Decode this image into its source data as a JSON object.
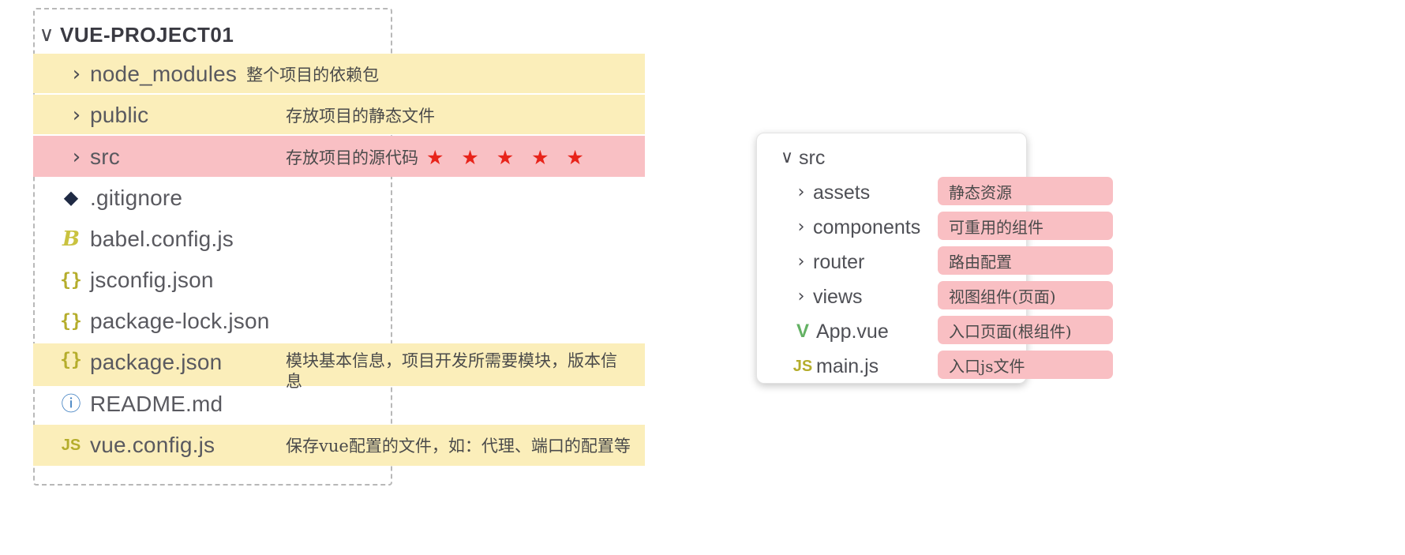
{
  "left_tree": {
    "root": {
      "label": "VUE-PROJECT01",
      "twisty": "∨"
    },
    "items": [
      {
        "twisty": "›",
        "name": "node_modules",
        "desc": "整个项目的依赖包",
        "highlight": "yellow",
        "icon": ""
      },
      {
        "twisty": "›",
        "name": "public",
        "desc": "存放项目的静态文件",
        "highlight": "yellow",
        "icon": ""
      },
      {
        "twisty": "›",
        "name": "src",
        "desc": "存放项目的源代码",
        "stars": "★ ★ ★ ★ ★",
        "highlight": "pink",
        "icon": ""
      },
      {
        "twisty": "",
        "name": ".gitignore",
        "desc": "",
        "highlight": "none",
        "icon": "git-icon",
        "glyph": "◆"
      },
      {
        "twisty": "",
        "name": "babel.config.js",
        "desc": "",
        "highlight": "none",
        "icon": "babel-icon",
        "glyph": "B"
      },
      {
        "twisty": "",
        "name": "jsconfig.json",
        "desc": "",
        "highlight": "none",
        "icon": "json-icon",
        "glyph": "{}"
      },
      {
        "twisty": "",
        "name": "package-lock.json",
        "desc": "",
        "highlight": "none",
        "icon": "json-icon",
        "glyph": "{}"
      },
      {
        "twisty": "",
        "name": "package.json",
        "desc": "模块基本信息，项目开发所需要模块，版本信息",
        "highlight": "yellow",
        "icon": "json-icon",
        "glyph": "{}"
      },
      {
        "twisty": "",
        "name": "README.md",
        "desc": "",
        "highlight": "none",
        "icon": "info-icon",
        "glyph": "ⓘ"
      },
      {
        "twisty": "",
        "name": "vue.config.js",
        "desc": "保存vue配置的文件，如：代理、端口的配置等",
        "highlight": "yellow",
        "icon": "js-icon",
        "glyph": "JS"
      }
    ]
  },
  "right_tree": {
    "root": {
      "label": "src",
      "twisty": "∨"
    },
    "items": [
      {
        "twisty": "›",
        "name": "assets",
        "label": "静态资源",
        "icon": "",
        "glyph": ""
      },
      {
        "twisty": "›",
        "name": "components",
        "label": "可重用的组件",
        "icon": "",
        "glyph": ""
      },
      {
        "twisty": "›",
        "name": "router",
        "label": "路由配置",
        "icon": "",
        "glyph": ""
      },
      {
        "twisty": "›",
        "name": "views",
        "label": "视图组件(页面)",
        "icon": "",
        "glyph": ""
      },
      {
        "twisty": "",
        "name": "App.vue",
        "label": "入口页面(根组件)",
        "icon": "vue-icon",
        "glyph": "V"
      },
      {
        "twisty": "",
        "name": "main.js",
        "label": "入口js文件",
        "icon": "js-icon",
        "glyph": "JS"
      }
    ]
  },
  "colors": {
    "highlight_yellow": "#fbeeba",
    "highlight_pink": "#f9c0c4",
    "label_pink": "#f9bfc3",
    "star_red": "#e8231a",
    "json_icon": "#b5ad2c",
    "vue_icon": "#63b163"
  }
}
